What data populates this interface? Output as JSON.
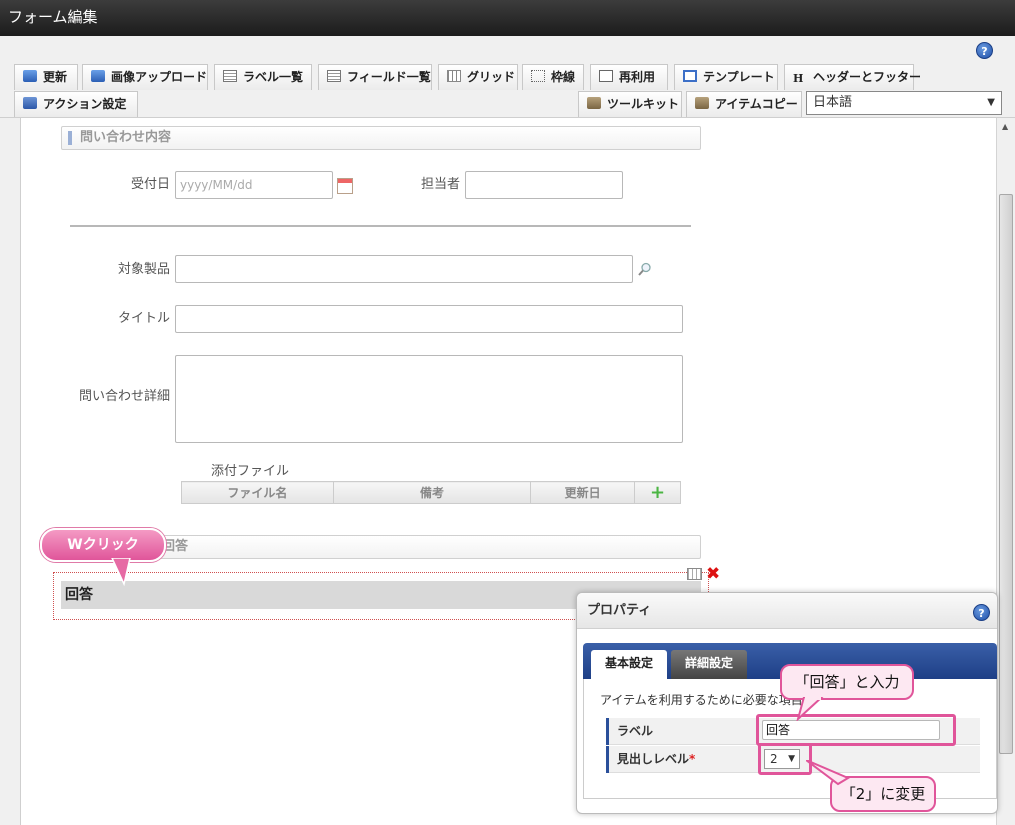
{
  "window": {
    "title": "フォーム編集"
  },
  "toolbar": {
    "row1": [
      "更新",
      "画像アップロード",
      "ラベル一覧",
      "フィールド一覧",
      "グリッド",
      "枠線",
      "再利用",
      "テンプレート",
      "ヘッダーとフッター"
    ],
    "action_settings": "アクション設定",
    "toolkit": "ツールキット",
    "item_copy": "アイテムコピー",
    "language": "日本語",
    "header_footer_icon": "H"
  },
  "form": {
    "section1": "問い合わせ内容",
    "received_date_label": "受付日",
    "received_date_placeholder": "yyyy/MM/dd",
    "assignee_label": "担当者",
    "product_label": "対象製品",
    "title_label": "タイトル",
    "detail_label": "問い合わせ詳細",
    "attach_label": "添付ファイル",
    "attach_columns": [
      "ファイル名",
      "備考",
      "更新日"
    ],
    "section2": "回答",
    "answer_heading": "回答"
  },
  "callouts": {
    "wclick": "Wクリック",
    "input_answer": "「回答」と入力",
    "change_2": "「2」に変更"
  },
  "property": {
    "title": "プロパティ",
    "tabs": [
      "基本設定",
      "詳細設定"
    ],
    "description": "アイテムを利用するために必要な項目",
    "label_label": "ラベル",
    "label_value": "回答",
    "heading_level_label": "見出しレベル",
    "required_mark": "*",
    "heading_level_value": "2"
  },
  "help": {
    "icon_text": "?"
  }
}
